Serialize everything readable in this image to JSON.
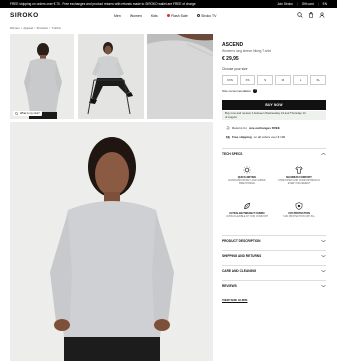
{
  "topbar": {
    "promo": "FREE shipping on orders over € 70 . Free exchanges and product returns with refunds made to SIROKO wallet are FREE of charge",
    "links": [
      "Join Siroko",
      "Gift card",
      "EN"
    ]
  },
  "header": {
    "logo": "SIROKO",
    "nav": [
      "Men",
      "Women",
      "Kids",
      "Flash Sale",
      "Siroko TV"
    ]
  },
  "breadcrumb": [
    "Women",
    "/",
    "Apparel",
    "/",
    "Products",
    "/",
    "T-shirts"
  ],
  "gallery": {
    "zoom_label": "What is my size?"
  },
  "product": {
    "name": "ASCEND",
    "description": "Women's long sleeve hiking T-shirt",
    "price": "€ 29,95",
    "size_label": "Choose your size",
    "sizes": [
      "XXS",
      "XS",
      "S",
      "M",
      "L",
      "XL"
    ],
    "size_recommendation": "Size recommendation",
    "buy_label": "BUY NOW",
    "delivery_line1": "Buy now and receive it between Wednesday 13 and Thursday 14",
    "delivery_line2": "of August"
  },
  "benefits": [
    {
      "prefix": "Returns for",
      "bold": "size exchanges FREE"
    },
    {
      "prefix": "Free shipping",
      "bold": "on all orders over € 100"
    }
  ],
  "accordion": {
    "tech_specs": "TECH SPECS",
    "description": "PRODUCT DESCRIPTION",
    "shipping": "SHIPPING AND RETURNS",
    "care": "CARE AND CLEANING",
    "reviews": "REVIEWS"
  },
  "features": [
    {
      "title": "QUICK-DRYING",
      "desc": "ENHANCES BODILY AND SUPER BREATHABLE"
    },
    {
      "title": "MAXIMUM COMFORT",
      "desc": "STRETCHES AND COMFORTABLE IN EVERY MOVEMENT"
    },
    {
      "title": "ULTRALIGHTWEIGHT FABRIC",
      "desc": "ULTRA FLEXIBLE FIT FOR COMFORT"
    },
    {
      "title": "UV6 PROTECTION",
      "desc": "SUN PROTECTION UPF 50+"
    }
  ],
  "size_guide": "VIEW SIZE GUIDE",
  "colors": {
    "accent_red": "#d9342b",
    "black": "#111111",
    "delivery_bg": "#eef1ee"
  }
}
